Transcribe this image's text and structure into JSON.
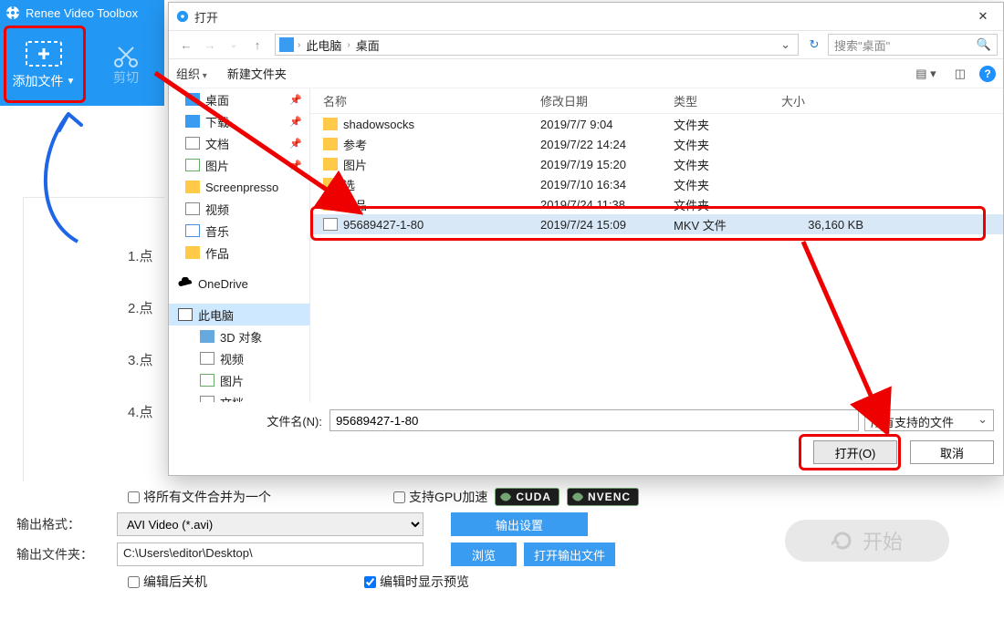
{
  "app": {
    "title": "Renee Video Toolbox",
    "add_file": "添加文件",
    "cut": "剪切"
  },
  "steps": {
    "s1": "1.点",
    "s2": "2.点",
    "s3": "3.点",
    "s4": "4.点"
  },
  "bottom": {
    "merge_all": "将所有文件合并为一个",
    "gpu": "支持GPU加速",
    "cuda": "CUDA",
    "nvenc": "NVENC",
    "out_format_lbl": "输出格式：",
    "out_format_val": "AVI Video (*.avi)",
    "out_settings": "输出设置",
    "out_folder_lbl": "输出文件夹：",
    "out_folder_val": "C:\\Users\\editor\\Desktop\\",
    "browse": "浏览",
    "open_out": "打开输出文件",
    "shutdown": "编辑后关机",
    "preview": "编辑时显示预览",
    "start": "开始"
  },
  "dialog": {
    "title": "打开",
    "breadcrumb": {
      "root_icon": "pc",
      "seg1": "此电脑",
      "seg2": "桌面"
    },
    "search_placeholder": "搜索\"桌面\"",
    "organize": "组织",
    "new_folder": "新建文件夹",
    "tree": {
      "desktop": "桌面",
      "downloads": "下载",
      "documents": "文档",
      "pictures": "图片",
      "screenpresso": "Screenpresso",
      "videos": "视频",
      "music": "音乐",
      "works": "作品",
      "onedrive": "OneDrive",
      "thispc": "此电脑",
      "obj3d": "3D 对象",
      "videos2": "视频",
      "pictures2": "图片",
      "documents2": "文档"
    },
    "columns": {
      "name": "名称",
      "date": "修改日期",
      "type": "类型",
      "size": "大小"
    },
    "rows": [
      {
        "name": "shadowsocks",
        "date": "2019/7/7 9:04",
        "type": "文件夹",
        "size": "",
        "kind": "folder"
      },
      {
        "name": "参考",
        "date": "2019/7/22 14:24",
        "type": "文件夹",
        "size": "",
        "kind": "folder"
      },
      {
        "name": "图片",
        "date": "2019/7/19 15:20",
        "type": "文件夹",
        "size": "",
        "kind": "folder"
      },
      {
        "name": "选",
        "date": "2019/7/10 16:34",
        "type": "文件夹",
        "size": "",
        "kind": "folder"
      },
      {
        "name": "作品",
        "date": "2019/7/24 11:38",
        "type": "文件夹",
        "size": "",
        "kind": "folder"
      },
      {
        "name": "95689427-1-80",
        "date": "2019/7/24 15:09",
        "type": "MKV 文件",
        "size": "36,160 KB",
        "kind": "file",
        "selected": true
      }
    ],
    "filename_lbl": "文件名(N):",
    "filename_val": "95689427-1-80",
    "filter": "所有支持的文件",
    "open_btn": "打开(O)",
    "cancel_btn": "取消"
  }
}
